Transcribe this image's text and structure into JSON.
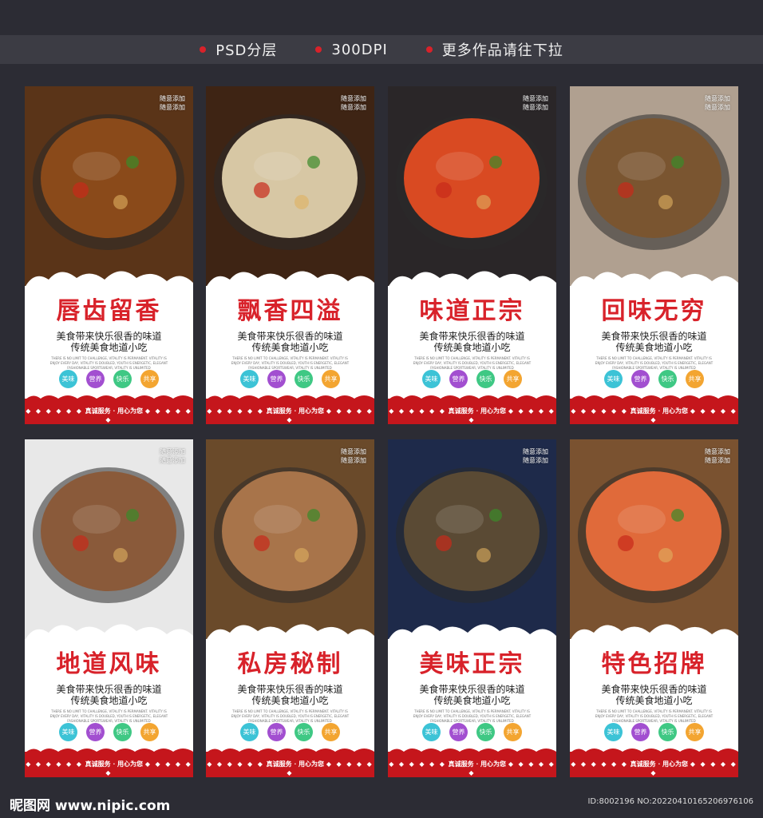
{
  "header": {
    "items": [
      "PSD分层",
      "300DPI",
      "更多作品请往下拉"
    ],
    "dot_color": "#d8222a"
  },
  "cards": [
    {
      "title": "唇齿留香",
      "watermark": [
        "随意添加",
        "随意添加"
      ],
      "dish_color": "#8a4a1a",
      "bg_color": "#5a3418"
    },
    {
      "title": "飘香四溢",
      "watermark": [
        "随意添加",
        "随意添加"
      ],
      "dish_color": "#d7c7a4",
      "bg_color": "#3e2414"
    },
    {
      "title": "味道正宗",
      "watermark": [
        "随意添加",
        "随意添加"
      ],
      "dish_color": "#d94a22",
      "bg_color": "#2a2628"
    },
    {
      "title": "回味无穷",
      "watermark": [
        "随意添加",
        "随意添加"
      ],
      "dish_color": "#7a5530",
      "bg_color": "#b0a090"
    },
    {
      "title": "地道风味",
      "watermark": [
        "随意添加",
        "随意添加"
      ],
      "dish_color": "#8a5a3a",
      "bg_color": "#e8e8e8"
    },
    {
      "title": "私房秘制",
      "watermark": [
        "随意添加",
        "随意添加"
      ],
      "dish_color": "#a8744a",
      "bg_color": "#6a4a2a"
    },
    {
      "title": "美味正宗",
      "watermark": [
        "随意添加",
        "随意添加"
      ],
      "dish_color": "#5a4a34",
      "bg_color": "#1e2a4a"
    },
    {
      "title": "特色招牌",
      "watermark": [
        "随意添加",
        "随意添加"
      ],
      "dish_color": "#e06a3a",
      "bg_color": "#7a5230"
    }
  ],
  "card_text": {
    "line1": "美食带来快乐很香的味道",
    "line2": "传统美食地道小吃",
    "english": "THERE IS NO LIMIT TO CHALLENGE, VITALITY IS PERMANENT. VITALITY IS ENJOY EVERY DAY, VITALITY IS DOUBLED, YOUTH IS ENERGETIC, ELEGANT FASHIONABLE SPORTSWEAR, VITALITY IS UNLIMITED",
    "tags": [
      {
        "label": "美味",
        "color": "#3cc3d6"
      },
      {
        "label": "营养",
        "color": "#a24fd0"
      },
      {
        "label": "快乐",
        "color": "#3fc884"
      },
      {
        "label": "共享",
        "color": "#f3a531"
      }
    ],
    "footer": "真诚服务 · 用心为您",
    "footer_dots": "◆ ◆ ◆ ◆ ◆ ◆",
    "footer_dots_right": "◆ ◆ ◆ ◆ ◆ ◆"
  },
  "bottom": {
    "logo": "昵图网 www.nipic.com",
    "id": "ID:8002196 NO:20220410165206976106"
  }
}
